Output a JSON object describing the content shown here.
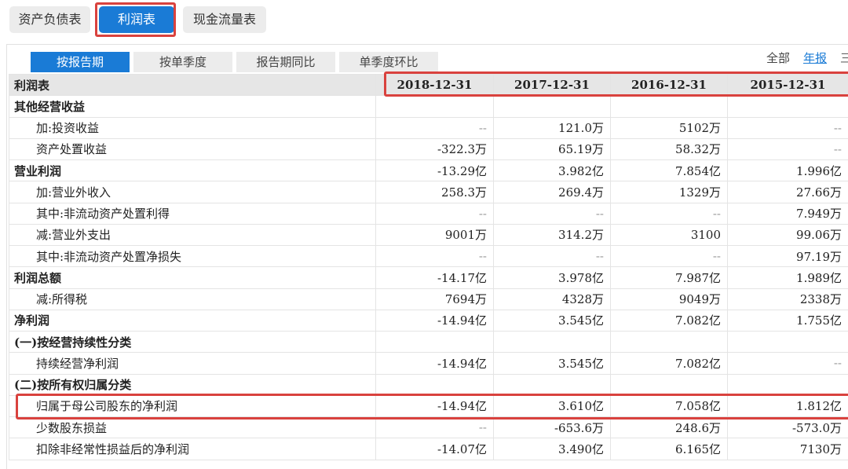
{
  "top_tabs": [
    {
      "label": "资产负债表",
      "active": false
    },
    {
      "label": "利润表",
      "active": true
    },
    {
      "label": "现金流量表",
      "active": false
    }
  ],
  "sub_tabs": [
    {
      "label": "按报告期",
      "active": true
    },
    {
      "label": "按单季度",
      "active": false
    },
    {
      "label": "报告期同比",
      "active": false
    },
    {
      "label": "单季度环比",
      "active": false
    }
  ],
  "right_controls": {
    "all": "全部",
    "annual": "年报",
    "more": "三"
  },
  "colors": {
    "accent": "#1a7bd6",
    "highlight": "#d9423e",
    "header_bg": "#e6e6e6"
  },
  "table": {
    "header": [
      "利润表",
      "2018-12-31",
      "2017-12-31",
      "2016-12-31",
      "2015-12-31"
    ],
    "rows": [
      {
        "label": "其他经营收益",
        "style": "bold",
        "values": [
          "",
          "",
          "",
          ""
        ]
      },
      {
        "label": "加:投资收益",
        "style": "sub",
        "values": [
          "--",
          "121.0万",
          "5102万",
          "--"
        ]
      },
      {
        "label": "资产处置收益",
        "style": "sub",
        "values": [
          "-322.3万",
          "65.19万",
          "58.32万",
          "--"
        ]
      },
      {
        "label": "营业利润",
        "style": "bold",
        "values": [
          "-13.29亿",
          "3.982亿",
          "7.854亿",
          "1.996亿"
        ]
      },
      {
        "label": "加:营业外收入",
        "style": "sub",
        "values": [
          "258.3万",
          "269.4万",
          "1329万",
          "27.66万"
        ]
      },
      {
        "label": "其中:非流动资产处置利得",
        "style": "sub",
        "values": [
          "--",
          "--",
          "--",
          "7.949万"
        ]
      },
      {
        "label": "减:营业外支出",
        "style": "sub",
        "values": [
          "9001万",
          "314.2万",
          "3100",
          "99.06万"
        ]
      },
      {
        "label": "其中:非流动资产处置净损失",
        "style": "sub",
        "values": [
          "--",
          "--",
          "--",
          "97.19万"
        ]
      },
      {
        "label": "利润总额",
        "style": "bold",
        "values": [
          "-14.17亿",
          "3.978亿",
          "7.987亿",
          "1.989亿"
        ]
      },
      {
        "label": "减:所得税",
        "style": "sub",
        "values": [
          "7694万",
          "4328万",
          "9049万",
          "2338万"
        ]
      },
      {
        "label": "净利润",
        "style": "bold",
        "values": [
          "-14.94亿",
          "3.545亿",
          "7.082亿",
          "1.755亿"
        ]
      },
      {
        "label": "(一)按经营持续性分类",
        "style": "bold",
        "values": [
          "",
          "",
          "",
          ""
        ]
      },
      {
        "label": "持续经营净利润",
        "style": "sub",
        "values": [
          "-14.94亿",
          "3.545亿",
          "7.082亿",
          "--"
        ]
      },
      {
        "label": "(二)按所有权归属分类",
        "style": "bold",
        "values": [
          "",
          "",
          "",
          ""
        ]
      },
      {
        "label": "归属于母公司股东的净利润",
        "style": "sub",
        "values": [
          "-14.94亿",
          "3.610亿",
          "7.058亿",
          "1.812亿"
        ]
      },
      {
        "label": "少数股东损益",
        "style": "sub",
        "values": [
          "--",
          "-653.6万",
          "248.6万",
          "-573.0万"
        ]
      },
      {
        "label": "扣除非经常性损益后的净利润",
        "style": "sub",
        "values": [
          "-14.07亿",
          "3.490亿",
          "6.165亿",
          "7130万"
        ]
      }
    ]
  }
}
